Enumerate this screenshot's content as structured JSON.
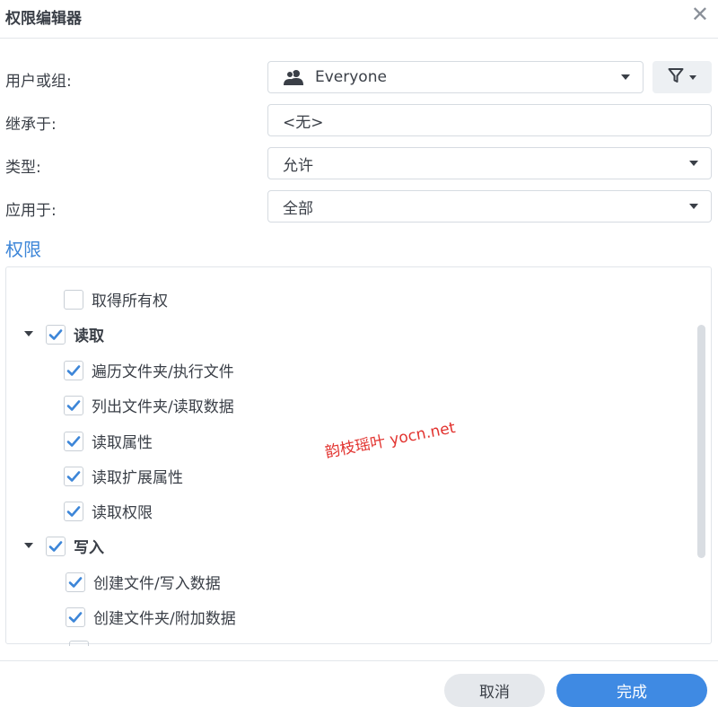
{
  "dialog": {
    "title": "权限编辑器",
    "close_glyph": "✕"
  },
  "form": {
    "user_label": "用户或组:",
    "user_value": "Everyone",
    "inherit_label": "继承于:",
    "inherit_value": "<无>",
    "type_label": "类型:",
    "type_value": "允许",
    "apply_label": "应用于:",
    "apply_value": "全部"
  },
  "permissions": {
    "section_title": "权限",
    "take_ownership": {
      "label": "取得所有权",
      "checked": false
    },
    "read": {
      "label": "读取",
      "checked": true,
      "expanded": true,
      "items": [
        {
          "label": "遍历文件夹/执行文件",
          "checked": true
        },
        {
          "label": "列出文件夹/读取数据",
          "checked": true
        },
        {
          "label": "读取属性",
          "checked": true
        },
        {
          "label": "读取扩展属性",
          "checked": true
        },
        {
          "label": "读取权限",
          "checked": true
        }
      ]
    },
    "write": {
      "label": "写入",
      "checked": true,
      "expanded": true,
      "items": [
        {
          "label": "创建文件/写入数据",
          "checked": true
        },
        {
          "label": "创建文件夹/附加数据",
          "checked": true
        }
      ]
    }
  },
  "buttons": {
    "cancel": "取消",
    "done": "完成"
  },
  "watermark": "韵枝瑶叶 yocn.net",
  "colors": {
    "accent": "#3f8ae3",
    "section_title": "#3d86d8",
    "check": "#3d86d8",
    "watermark": "#e2332f"
  }
}
